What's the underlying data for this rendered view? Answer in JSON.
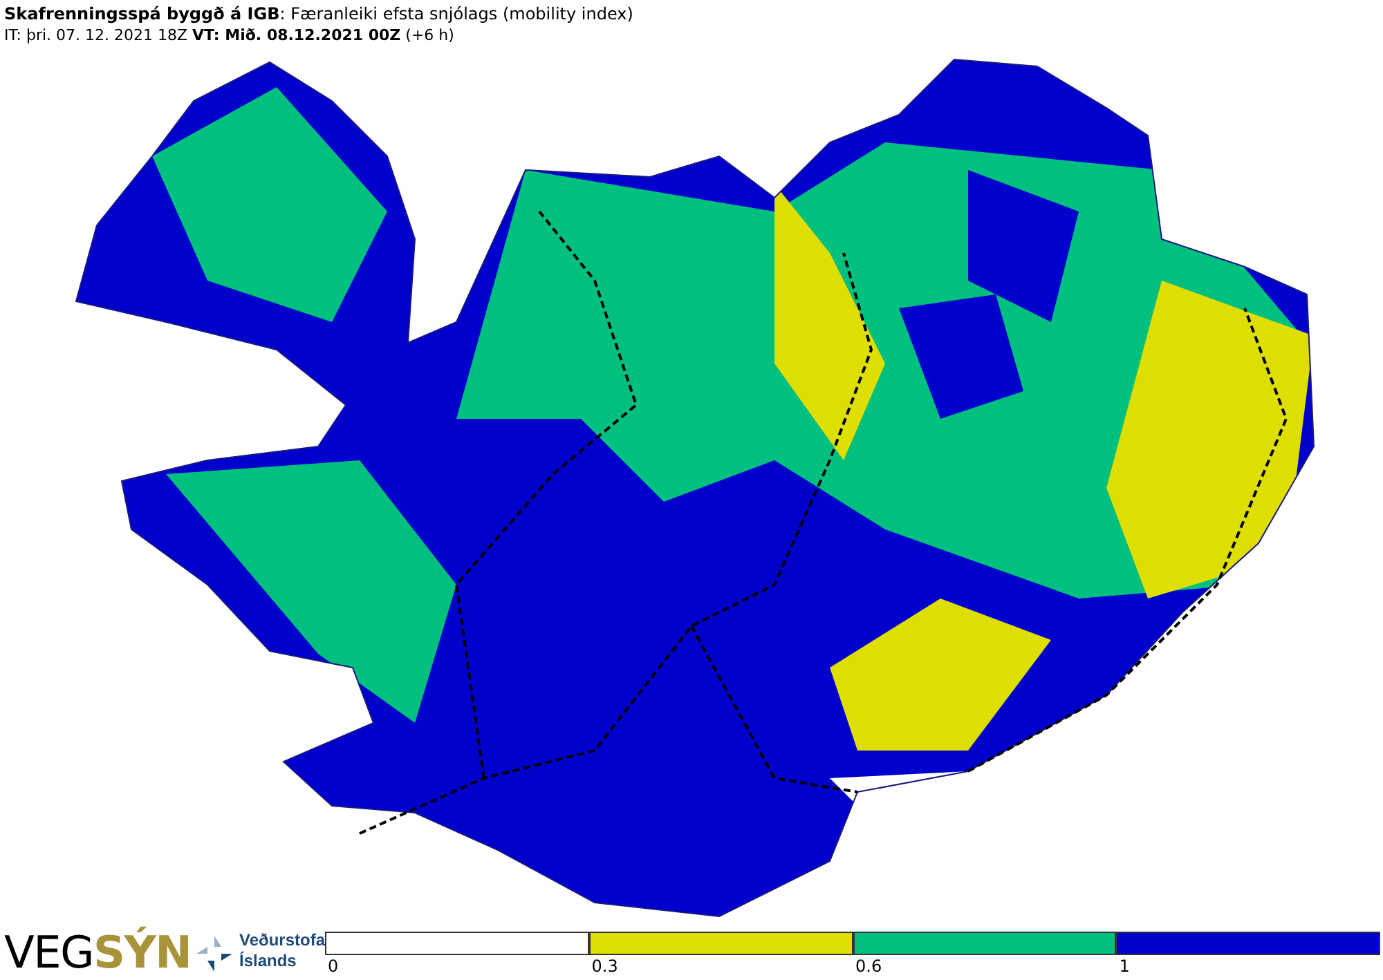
{
  "header": {
    "title": "**Skafrenningsspá byggð á IGB**: Færanleiki efsta snjólags (mobility index)",
    "subtitle": "IT: þri. 07. 12. 2021 18Z **VT: Mið. 08.12.2021 00Z** (+6 h)"
  },
  "logos": {
    "vegsyn_first": "VEG",
    "vegsyn_second": "SÝN",
    "vedurstofa_line1": "Veðurstofa",
    "vedurstofa_line2": "Íslands"
  },
  "legend": [
    {
      "label": "0",
      "color": "#ffffff"
    },
    {
      "label": "0.3",
      "color": "#dede00"
    },
    {
      "label": "0.6",
      "color": "#00c080"
    },
    {
      "label": "1",
      "color": "#0000cc"
    }
  ]
}
